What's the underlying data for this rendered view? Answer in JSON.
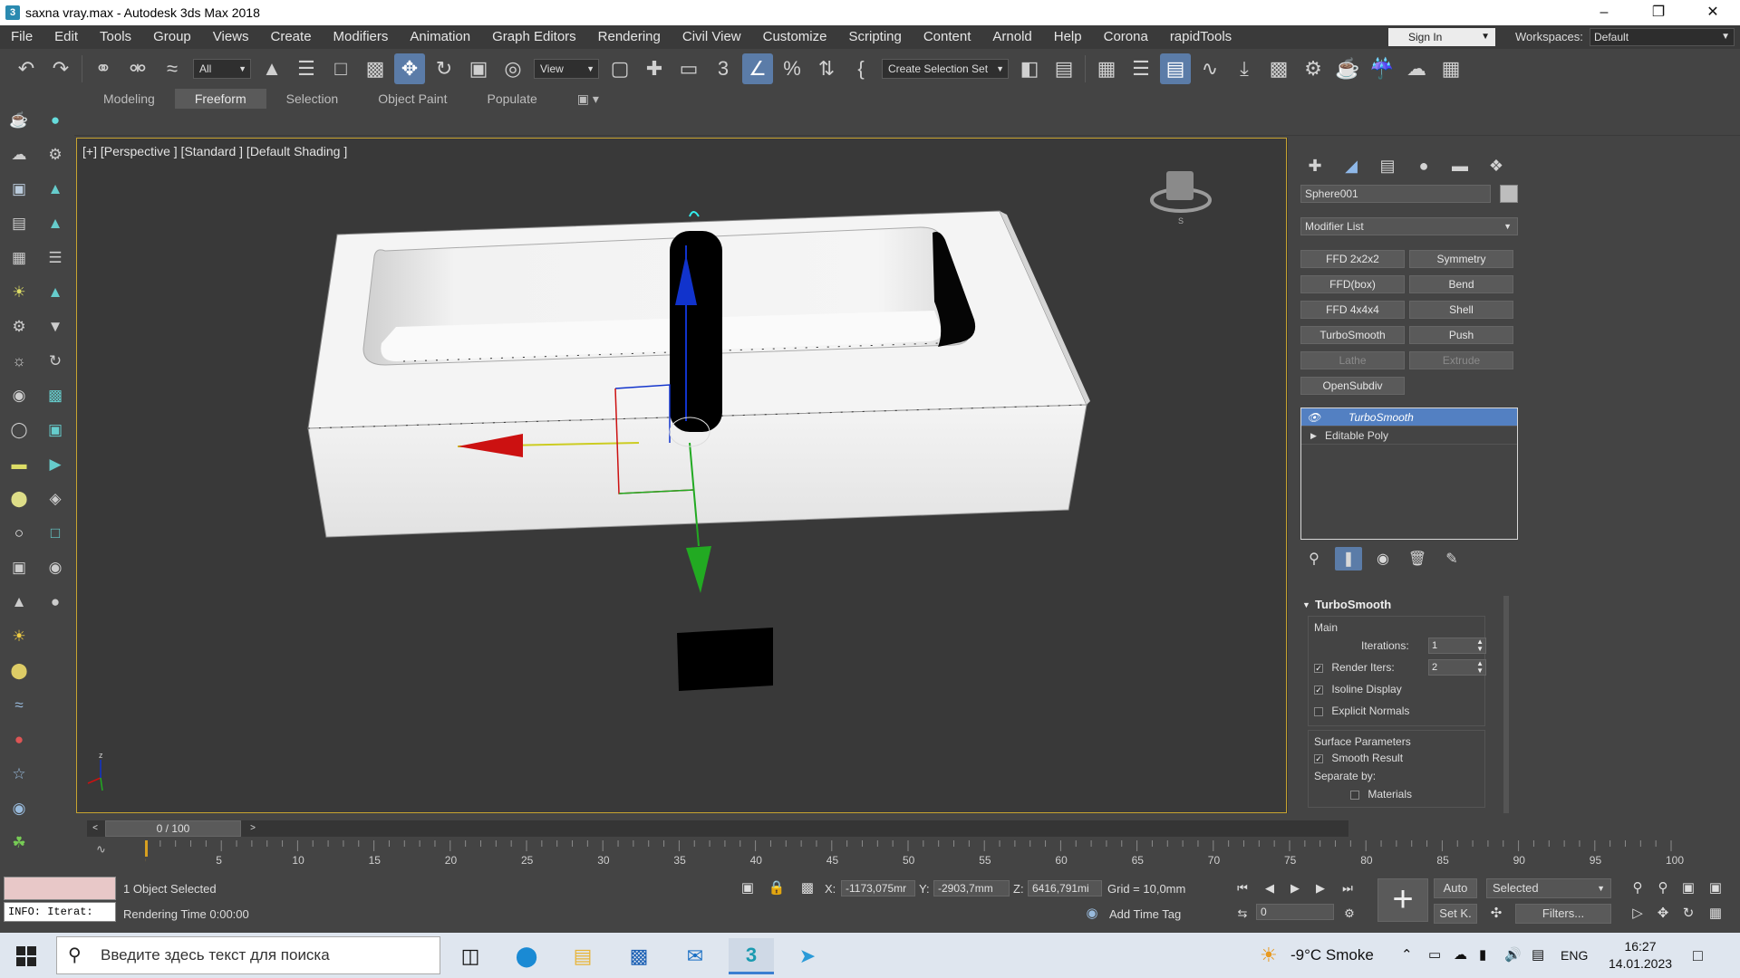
{
  "window": {
    "title": "saxna vray.max - Autodesk 3ds Max 2018",
    "app_icon": "3"
  },
  "menu": [
    "File",
    "Edit",
    "Tools",
    "Group",
    "Views",
    "Create",
    "Modifiers",
    "Animation",
    "Graph Editors",
    "Rendering",
    "Civil View",
    "Customize",
    "Scripting",
    "Content",
    "Arnold",
    "Help",
    "Corona",
    "rapidTools"
  ],
  "account": {
    "signin": "Sign In",
    "workspaces_label": "Workspaces:",
    "workspace": "Default"
  },
  "toolbar": {
    "filter": "All",
    "ref_coord": "View",
    "selection_set": "Create Selection Set"
  },
  "ribbon_tabs": [
    "Modeling",
    "Freeform",
    "Selection",
    "Object Paint",
    "Populate"
  ],
  "viewport": {
    "label": "[+] [Perspective ] [Standard ] [Default Shading ]"
  },
  "command_panel": {
    "object_name": "Sphere001",
    "modifier_list": "Modifier List",
    "modifier_buttons": [
      {
        "label": "FFD 2x2x2",
        "enabled": true
      },
      {
        "label": "Symmetry",
        "enabled": true
      },
      {
        "label": "FFD(box)",
        "enabled": true
      },
      {
        "label": "Bend",
        "enabled": true
      },
      {
        "label": "FFD 4x4x4",
        "enabled": true
      },
      {
        "label": "Shell",
        "enabled": true
      },
      {
        "label": "TurboSmooth",
        "enabled": true
      },
      {
        "label": "Push",
        "enabled": true
      },
      {
        "label": "Lathe",
        "enabled": false
      },
      {
        "label": "Extrude",
        "enabled": false
      },
      {
        "label": "OpenSubdiv",
        "enabled": true
      }
    ],
    "stack": [
      "TurboSmooth",
      "Editable Poly"
    ],
    "rollout": {
      "title": "TurboSmooth",
      "main_label": "Main",
      "iterations_label": "Iterations:",
      "iterations": "1",
      "render_iters_label": "Render Iters:",
      "render_iters": "2",
      "isoline": "Isoline Display",
      "explicit_normals": "Explicit Normals",
      "surface_params": "Surface Parameters",
      "smooth_result": "Smooth Result",
      "separate_by": "Separate by:",
      "materials": "Materials"
    }
  },
  "timeline": {
    "frame": "0 / 100",
    "ticks": [
      "0",
      "5",
      "10",
      "15",
      "20",
      "25",
      "30",
      "35",
      "40",
      "45",
      "50",
      "55",
      "60",
      "65",
      "70",
      "75",
      "80",
      "85",
      "90",
      "95",
      "100"
    ]
  },
  "status": {
    "info": "INFO: Iterat:",
    "selected": "1 Object Selected",
    "render_time": "Rendering Time  0:00:00",
    "x_label": "X:",
    "x": "-1173,075mr",
    "y_label": "Y:",
    "y": "-2903,7mm",
    "z_label": "Z:",
    "z": "6416,791mi",
    "grid": "Grid = 10,0mm",
    "add_time_tag": "Add Time Tag",
    "auto": "Auto",
    "selected_mode": "Selected",
    "set_key": "Set K.",
    "filters": "Filters...",
    "frame_field": "0"
  },
  "taskbar": {
    "search_placeholder": "Введите здесь текст для поиска",
    "weather": "-9°C  Smoke",
    "lang": "ENG",
    "time": "16:27",
    "date": "14.01.2023"
  },
  "colors": {
    "accent": "#5380c2",
    "viewport_border": "#c8a430",
    "x_axis": "#cc1111",
    "y_axis": "#22aa22",
    "z_axis": "#1133cc"
  }
}
